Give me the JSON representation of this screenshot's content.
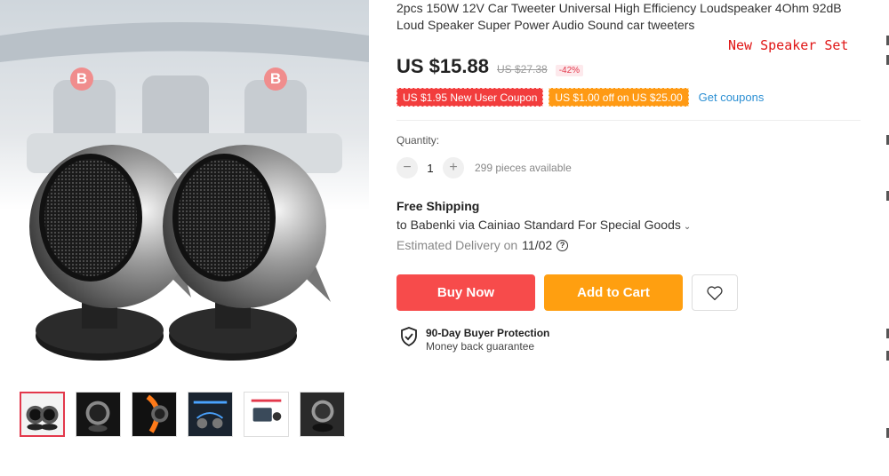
{
  "product": {
    "title": "2pcs 150W 12V Car Tweeter Universal High Efficiency Loudspeaker 4Ohm 92dB Loud Speaker Super Power Audio Sound car tweeters",
    "overlay_label": "New Speaker Set",
    "badge_letter": "B"
  },
  "price": {
    "current": "US $15.88",
    "original": "US $27.38",
    "discount": "-42%"
  },
  "coupons": {
    "new_user": "US $1.95 New User Coupon",
    "off": "US $1.00 off on US $25.00",
    "get_link": "Get coupons"
  },
  "quantity": {
    "label": "Quantity:",
    "minus": "−",
    "plus": "+",
    "value": "1",
    "available": "299 pieces available"
  },
  "shipping": {
    "title": "Free Shipping",
    "to": "to Babenki via Cainiao Standard For Special Goods",
    "chevron": "⌄",
    "delivery_label": "Estimated Delivery on",
    "delivery_date": "11/02",
    "help": "?"
  },
  "actions": {
    "buy_now": "Buy Now",
    "add_to_cart": "Add to Cart"
  },
  "protection": {
    "title": "90-Day Buyer Protection",
    "subtitle": "Money back guarantee"
  },
  "colors": {
    "accent_red": "#f74b4b",
    "accent_orange": "#ff9f10",
    "link_blue": "#2b8fd3"
  }
}
